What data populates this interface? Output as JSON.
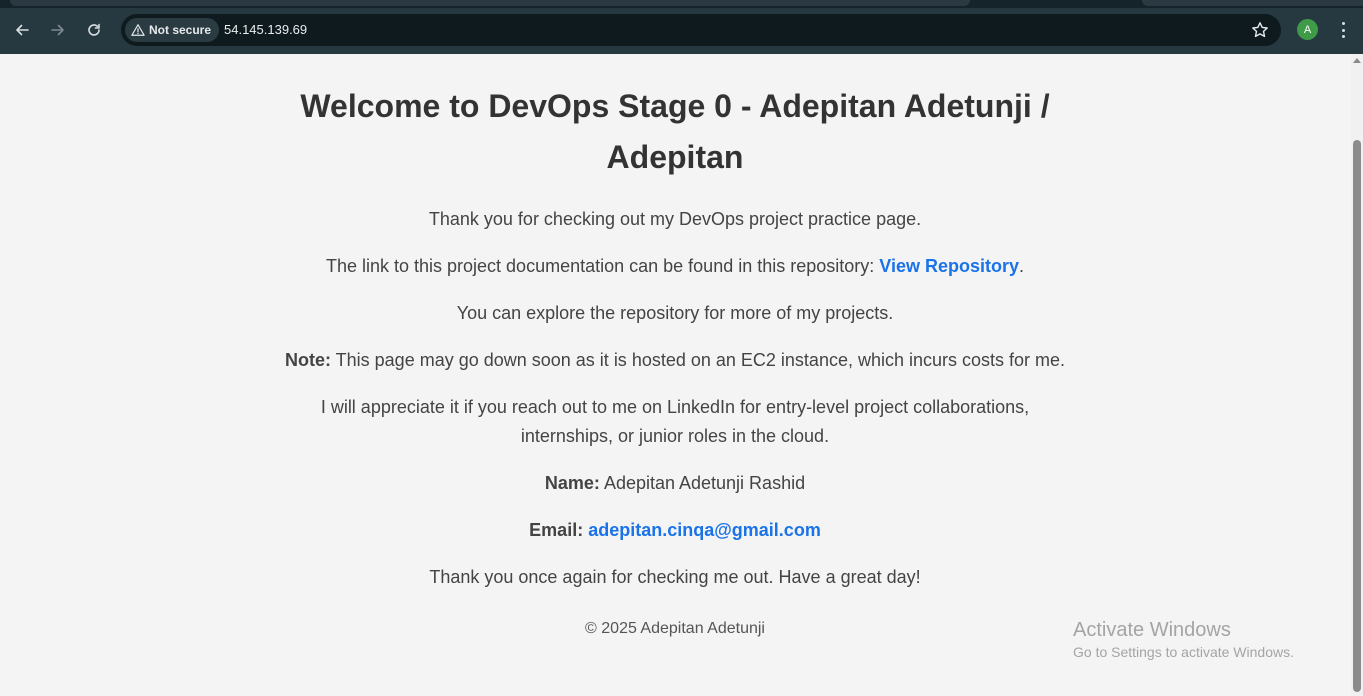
{
  "browser": {
    "security_chip": "Not secure",
    "url": "54.145.139.69",
    "profile_initial": "A"
  },
  "page": {
    "heading": "Welcome to DevOps Stage 0 - Adepitan Adetunji / Adepitan",
    "intro": "Thank you for checking out my DevOps project practice page.",
    "repo_prefix": "The link to this project documentation can be found in this repository:",
    "repo_link": "View Repository",
    "repo_suffix": ".",
    "explore": "You can explore the repository for more of my projects.",
    "note_label": "Note:",
    "note_text": "This page may go down soon as it is hosted on an EC2 instance, which incurs costs for me.",
    "appreciate": "I will appreciate it if you reach out to me on LinkedIn for entry-level project collaborations, internships, or junior roles in the cloud.",
    "name_label": "Name:",
    "name_value": "Adepitan Adetunji Rashid",
    "email_label": "Email:",
    "email_value": "adepitan.cinqa@gmail.com",
    "thanks": "Thank you once again for checking me out. Have a great day!",
    "footer": "© 2025 Adepitan Adetunji"
  },
  "watermark": {
    "title": "Activate Windows",
    "subtitle": "Go to Settings to activate Windows."
  },
  "colors": {
    "link": "#1a73e8",
    "page_background": "#f4f4f4",
    "toolbar": "#263840"
  },
  "icons": [
    "back-arrow-icon",
    "forward-arrow-icon",
    "reload-icon",
    "warning-triangle-icon",
    "star-icon",
    "kebab-menu-icon"
  ]
}
